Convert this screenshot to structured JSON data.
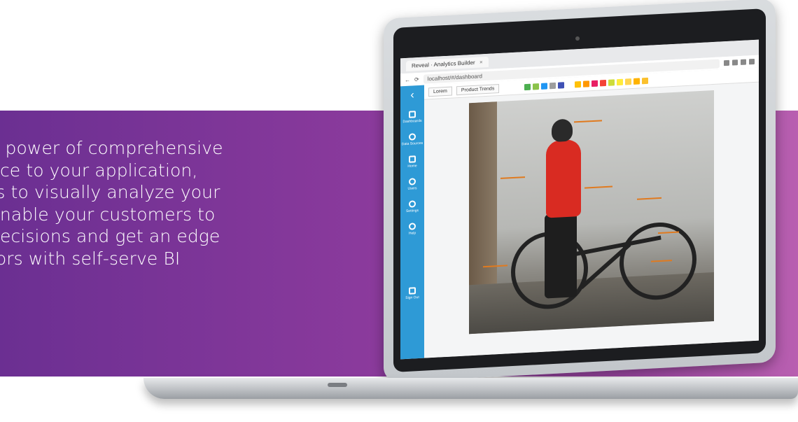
{
  "headline": {
    "lines": [
      "e power of comprehensive",
      "nce to your application,",
      "rs to visually analyze your",
      "Enable your customers to",
      "decisions and get an edge",
      "tors with self-serve BI"
    ]
  },
  "colors": {
    "band_start": "#6b2f92",
    "band_end": "#b85fb0",
    "sidebar": "#2e9ad6",
    "jersey": "#d92b22",
    "sparkline": "#e07a1f"
  },
  "browser": {
    "tab_title": "Reveal · Analytics Builder",
    "url": "localhost/#/dashboard"
  },
  "app": {
    "subtabs": [
      "Lorem",
      "Product Trends"
    ],
    "sidebar_items": [
      {
        "icon": "grid-icon",
        "label": "Dashboards"
      },
      {
        "icon": "database-icon",
        "label": "Data Sources"
      },
      {
        "icon": "home-icon",
        "label": "Home"
      },
      {
        "icon": "user-icon",
        "label": "Users"
      },
      {
        "icon": "gear-icon",
        "label": "Settings"
      },
      {
        "icon": "globe-icon",
        "label": "Help"
      },
      {
        "icon": "logout-icon",
        "label": "Sign Out"
      }
    ],
    "palette_colors": [
      "#4caf50",
      "#8bc34a",
      "#2196f3",
      "#9e9e9e",
      "#3f51b5",
      "#ffffff",
      "#ffc107",
      "#ff9800",
      "#e91e63",
      "#f44336",
      "#cddc39",
      "#ffeb3b",
      "#ffd54f",
      "#ffb300",
      "#fbc02d"
    ]
  }
}
